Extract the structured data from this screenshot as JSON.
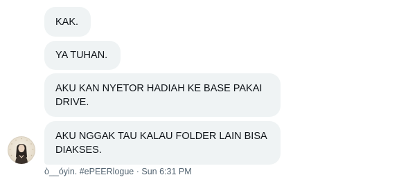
{
  "messages": [
    {
      "text": "KAK."
    },
    {
      "text": "YA TUHAN."
    },
    {
      "text": "AKU KAN NYETOR HADIAH KE BASE PAKAI\nDRIVE."
    },
    {
      "text": "AKU NGGAK TAU KALAU FOLDER LAIN BISA\nDIAKSES."
    }
  ],
  "sender": {
    "name": "ò__óyin. #ePEERlogue",
    "separator": " · ",
    "timestamp": "Sun 6:31 PM",
    "avatar_icon": "profile-avatar-illustration"
  },
  "colors": {
    "bubble_bg": "#eff3f4",
    "text": "#0f1419",
    "meta_text": "#536471"
  }
}
